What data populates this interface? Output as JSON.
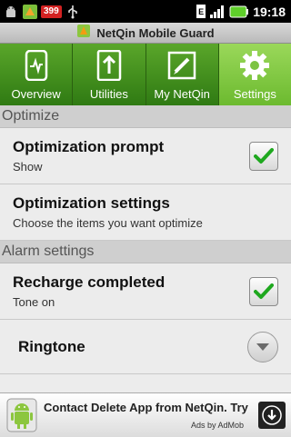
{
  "statusbar": {
    "notification_icons": [
      "android-debug-icon",
      "app-notification-icon",
      "calendar-icon",
      "usb-icon"
    ],
    "badge_count": "399",
    "time": "19:18",
    "network": "E"
  },
  "app": {
    "title": "NetQin Mobile Guard",
    "accent": "#4a9a22"
  },
  "tabs": [
    {
      "label": "Overview",
      "icon": "phone-chart-icon",
      "active": false
    },
    {
      "label": "Utilities",
      "icon": "upload-arrow-icon",
      "active": false
    },
    {
      "label": "My NetQin",
      "icon": "edit-box-icon",
      "active": false
    },
    {
      "label": "Settings",
      "icon": "gear-icon",
      "active": true
    }
  ],
  "sections": [
    {
      "header": "Optimize",
      "rows": [
        {
          "title": "Optimization prompt",
          "subtitle": "Show",
          "control": "checkbox",
          "checked": true
        },
        {
          "title": "Optimization settings",
          "subtitle": "Choose the items you want optimize",
          "control": "none"
        }
      ]
    },
    {
      "header": "Alarm settings",
      "rows": [
        {
          "title": "Recharge completed",
          "subtitle": "Tone on",
          "control": "checkbox",
          "checked": true
        },
        {
          "title": "Ringtone",
          "subtitle": "",
          "control": "dropdown"
        }
      ]
    }
  ],
  "ad": {
    "text": "Contact Delete App from NetQin. Try",
    "attribution": "Ads by AdMob"
  }
}
